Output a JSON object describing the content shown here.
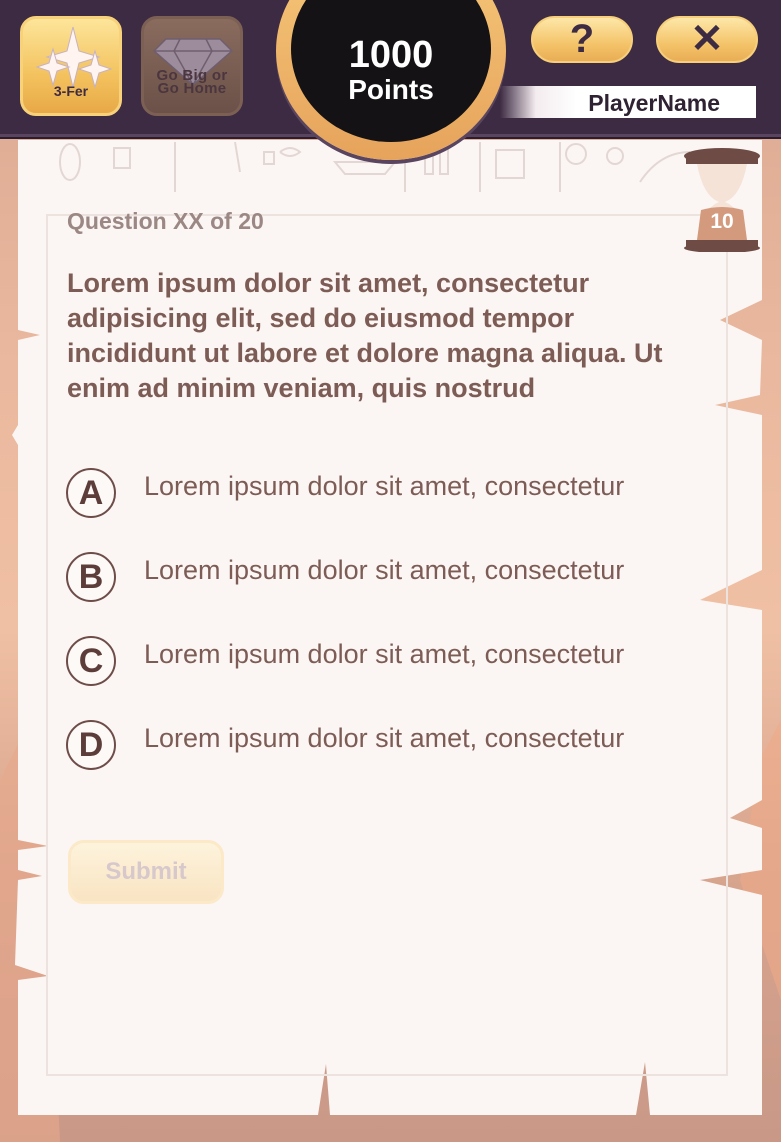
{
  "header": {
    "powerups": [
      {
        "label": "3-Fer",
        "icon": "sparkles-icon",
        "state": "active"
      },
      {
        "label": "Go Big or Go Home",
        "line1": "Go Big or",
        "line2": "Go Home",
        "icon": "diamond-icon",
        "state": "disabled"
      }
    ],
    "points": {
      "value": "1000",
      "unit": "Points"
    },
    "help_label": "?",
    "close_label": "✕",
    "player_name": "PlayerName"
  },
  "timer": {
    "value": "10",
    "icon": "hourglass-icon"
  },
  "question": {
    "counter": "Question XX of 20",
    "text": "Lorem ipsum dolor sit amet, consectetur adipisicing elit, sed do eiusmod tempor incididunt ut labore et dolore magna aliqua. Ut enim ad minim veniam, quis nostrud"
  },
  "answers": [
    {
      "letter": "A",
      "text": "Lorem ipsum dolor sit amet, consectetur"
    },
    {
      "letter": "B",
      "text": "Lorem ipsum dolor sit amet, consectetur"
    },
    {
      "letter": "C",
      "text": "Lorem ipsum dolor sit amet, consectetur"
    },
    {
      "letter": "D",
      "text": "Lorem ipsum dolor sit amet, consectetur"
    }
  ],
  "submit_label": "Submit",
  "colors": {
    "topbar": "#3d2b43",
    "accent_gold": "#f4c46a",
    "question_text": "#7d5c56",
    "parchment": "#fbf7f5"
  }
}
